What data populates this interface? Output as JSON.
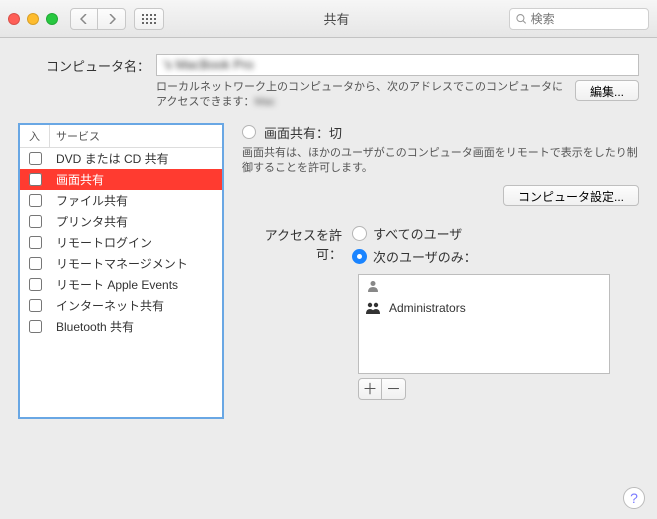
{
  "window": {
    "title": "共有",
    "search_placeholder": "検索"
  },
  "computer_name": {
    "label": "コンピュータ名：",
    "value_prefix": "  's Mac",
    "value_blur": "Book Pro",
    "address_text_1": "ローカルネットワーク上のコンピュータから、次のアドレスでこのコンピュータにアクセスできます：",
    "address_blur": "   Mac      ",
    "edit_button": "編集..."
  },
  "services": {
    "col_on": "入",
    "col_service": "サービス",
    "items": [
      {
        "label": "DVD または CD 共有",
        "on": false,
        "selected": false
      },
      {
        "label": "画面共有",
        "on": false,
        "selected": true
      },
      {
        "label": "ファイル共有",
        "on": false,
        "selected": false
      },
      {
        "label": "プリンタ共有",
        "on": false,
        "selected": false
      },
      {
        "label": "リモートログイン",
        "on": false,
        "selected": false
      },
      {
        "label": "リモートマネージメント",
        "on": false,
        "selected": false
      },
      {
        "label": "リモート Apple Events",
        "on": false,
        "selected": false
      },
      {
        "label": "インターネット共有",
        "on": false,
        "selected": false
      },
      {
        "label": "Bluetooth 共有",
        "on": false,
        "selected": false
      }
    ]
  },
  "detail": {
    "status_title": "画面共有：切",
    "status_desc": "画面共有は、ほかのユーザがこのコンピュータ画面をリモートで表示をしたり制御することを許可します。",
    "computer_settings_button": "コンピュータ設定...",
    "access_label": "アクセスを許可：",
    "radio_all_users": "すべてのユーザ",
    "radio_only_users": "次のユーザのみ：",
    "radio_selected": "only",
    "user_list": [
      {
        "label": "      ",
        "icon": "person",
        "dim": true
      },
      {
        "label": "Administrators",
        "icon": "group",
        "dim": false
      }
    ]
  }
}
